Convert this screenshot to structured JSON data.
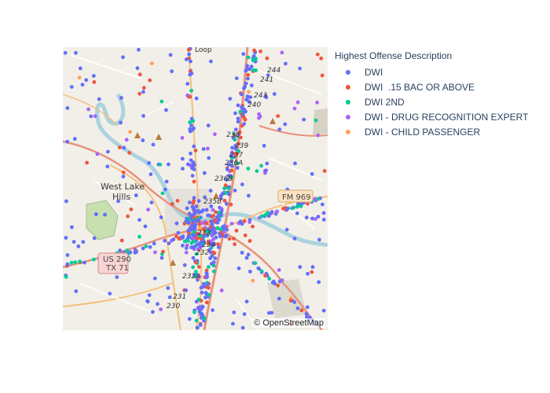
{
  "legend": {
    "title": "Highest Offense Description",
    "items": [
      {
        "label": "DWI",
        "color": "#636efa"
      },
      {
        "label": "DWI  .15 BAC OR ABOVE",
        "color": "#EF553B"
      },
      {
        "label": "DWI 2ND",
        "color": "#00cc96"
      },
      {
        "label": "DWI - DRUG RECOGNITION EXPERT",
        "color": "#ab63fa"
      },
      {
        "label": "DWI - CHILD PASSENGER",
        "color": "#FFA15A"
      }
    ]
  },
  "map": {
    "attribution": "© OpenStreetMap",
    "labels": {
      "west_lake": "West Lake",
      "hills": "Hills",
      "us290": "US 290",
      "tx71": "TX 71",
      "fm969": "FM 969",
      "loop": "Loop",
      "exit_244": "244",
      "exit_241": "241",
      "exit_243": "243",
      "exit_240": "240",
      "exit_238": "238",
      "exit_239": "239",
      "exit_237": "237",
      "exit_236a": "236A",
      "exit_236b": "236B",
      "exit_235b": "235B",
      "exit_233": "233",
      "exit_234": "234",
      "exit_232": "232",
      "exit_232a": "232A",
      "exit_231": "231",
      "exit_230": "230"
    }
  }
}
